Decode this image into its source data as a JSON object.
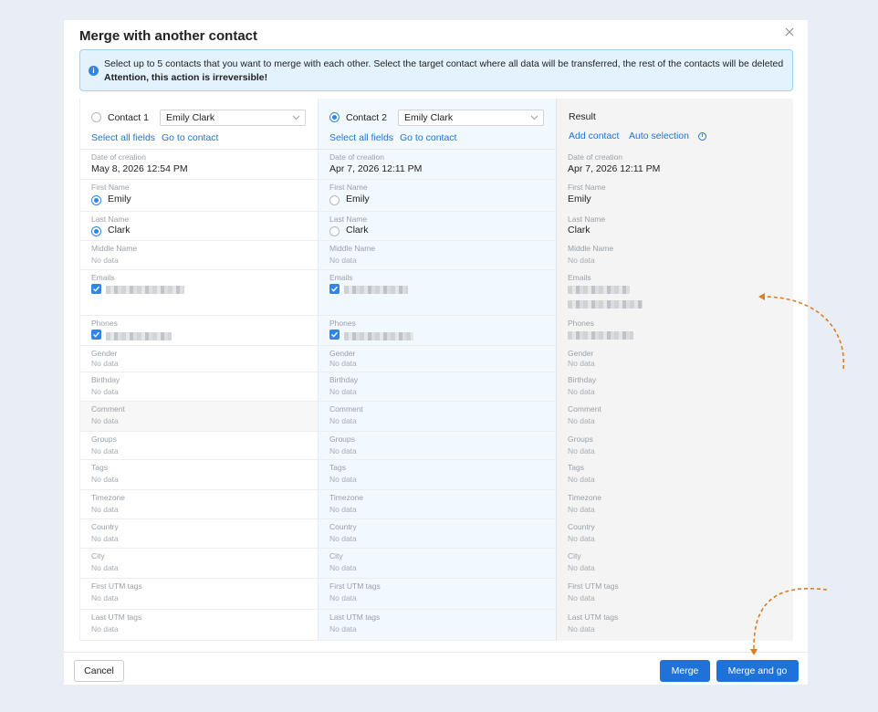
{
  "dialog": {
    "title": "Merge with another contact",
    "notice_text": "Select up to 5 contacts that you want to merge with each other. Select the target contact where all data will be transferred, the rest of the contacts will be deleted",
    "notice_warning": "Attention, this action is irreversible!"
  },
  "contact1": {
    "label": "Contact 1",
    "selected_contact": "Emily Clark",
    "select_all": "Select all fields",
    "go_to": "Go to contact",
    "date_of_creation": "May 8, 2026 12:54 PM",
    "first_name": "Emily",
    "last_name": "Clark"
  },
  "contact2": {
    "label": "Contact 2",
    "selected_contact": "Emily Clark",
    "select_all": "Select all fields",
    "go_to": "Go to contact",
    "date_of_creation": "Apr 7, 2026 12:11 PM",
    "first_name": "Emily",
    "last_name": "Clark"
  },
  "result": {
    "title": "Result",
    "add_contact": "Add contact",
    "auto_selection": "Auto selection",
    "date_of_creation": "Apr 7, 2026 12:11 PM",
    "first_name": "Emily",
    "last_name": "Clark"
  },
  "labels": {
    "date_of_creation": "Date of creation",
    "first_name": "First Name",
    "last_name": "Last Name",
    "middle_name": "Middle Name",
    "emails": "Emails",
    "phones": "Phones",
    "gender": "Gender",
    "birthday": "Birthday",
    "comment": "Comment",
    "groups": "Groups",
    "tags": "Tags",
    "timezone": "Timezone",
    "country": "Country",
    "city": "City",
    "first_utm": "First UTM tags",
    "last_utm": "Last UTM tags"
  },
  "no_data": "No data",
  "footer": {
    "cancel": "Cancel",
    "merge": "Merge",
    "merge_and_go": "Merge and go"
  },
  "colors": {
    "accent": "#1f73d8",
    "annotation": "#e07b1f"
  },
  "icons": {
    "close": "close-icon",
    "info": "info-icon",
    "dropdown": "chevron-down-icon",
    "check": "checkmark-icon"
  }
}
